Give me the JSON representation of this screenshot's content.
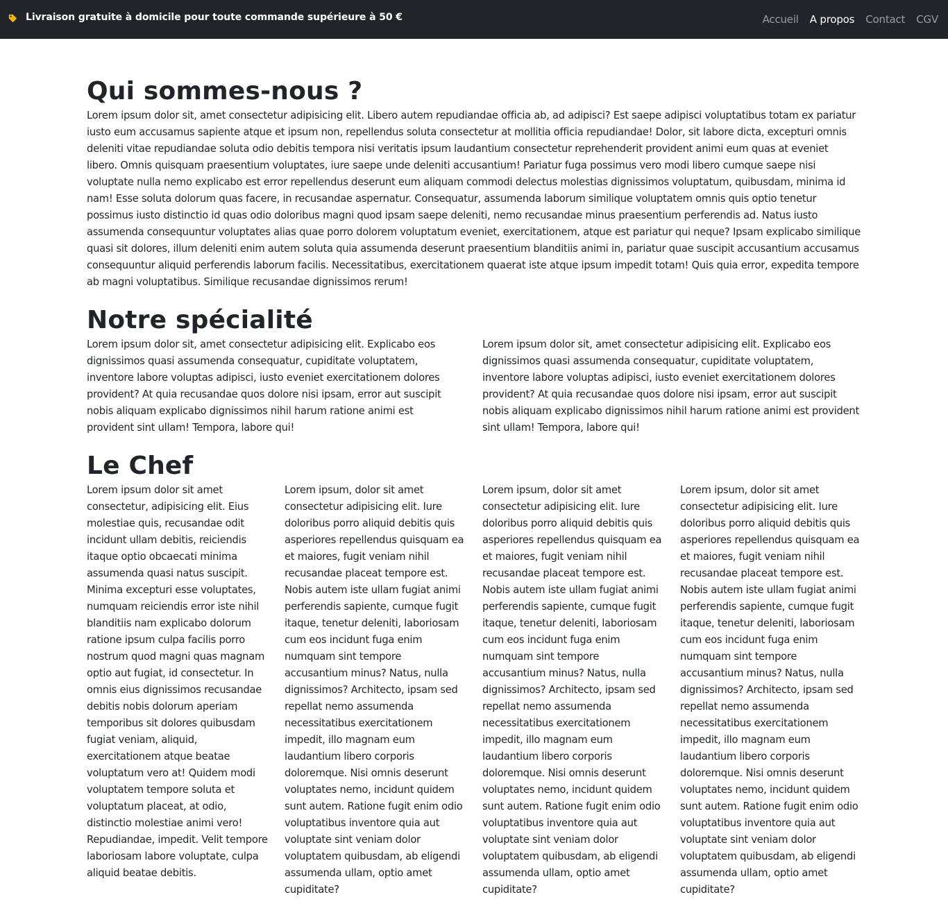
{
  "topbar": {
    "promo_icon": "tag-icon",
    "promo_text": "Livraison gratuite à domicile pour toute commande supérieure à 50 €",
    "nav": [
      {
        "label": "Accueil",
        "active": false
      },
      {
        "label": "A propos",
        "active": true
      },
      {
        "label": "Contact",
        "active": false
      },
      {
        "label": "CGV",
        "active": false
      }
    ]
  },
  "colors": {
    "navbar_bg": "#212529",
    "tag_icon": "#f5b800"
  },
  "sections": {
    "about": {
      "title": "Qui sommes-nous ?",
      "text": "Lorem ipsum dolor sit, amet consectetur adipisicing elit. Libero autem repudiandae officia ab, ad adipisci? Est saepe adipisci voluptatibus totam ex pariatur iusto eum accusamus sapiente atque et ipsum non, repellendus soluta consectetur at mollitia officia repudiandae! Dolor, sit labore dicta, excepturi omnis deleniti vitae repudiandae soluta odio debitis tempora nisi veritatis ipsum laudantium consectetur reprehenderit provident animi eum quas at eveniet libero. Omnis quisquam praesentium voluptates, iure saepe unde deleniti accusantium! Pariatur fuga possimus vero modi libero cumque saepe nisi voluptate nulla nemo explicabo est error repellendus deserunt eum aliquam commodi delectus molestias dignissimos voluptatum, quibusdam, minima id nam! Esse soluta dolorum quas facere, in recusandae aspernatur. Consequatur, assumenda laborum similique voluptatem omnis quis optio tenetur possimus iusto distinctio id quas odio doloribus magni quod ipsam saepe deleniti, nemo recusandae minus praesentium perferendis ad. Natus iusto assumenda consequuntur voluptates alias quae porro dolorem voluptatum eveniet, exercitationem, atque est pariatur qui neque? Ipsam explicabo similique quasi sit dolores, illum deleniti enim autem soluta quia assumenda deserunt praesentium blanditiis animi in, pariatur quae suscipit accusantium accusamus consequuntur aliquid perferendis laborum facilis. Necessitatibus, exercitationem quaerat iste atque ipsum impedit totam! Quis quia error, expedita tempore ab magni voluptatibus. Similique recusandae dignissimos rerum!"
    },
    "specialty": {
      "title": "Notre spécialité",
      "columns": [
        "Lorem ipsum dolor sit, amet consectetur adipisicing elit. Explicabo eos dignissimos quasi assumenda consequatur, cupiditate voluptatem, inventore labore voluptas adipisci, iusto eveniet exercitationem dolores provident? At quia recusandae quos dolore nisi ipsam, error aut suscipit nobis aliquam explicabo dignissimos nihil harum ratione animi est provident sint ullam! Tempora, labore qui!",
        "Lorem ipsum dolor sit, amet consectetur adipisicing elit. Explicabo eos dignissimos quasi assumenda consequatur, cupiditate voluptatem, inventore labore voluptas adipisci, iusto eveniet exercitationem dolores provident? At quia recusandae quos dolore nisi ipsam, error aut suscipit nobis aliquam explicabo dignissimos nihil harum ratione animi est provident sint ullam! Tempora, labore qui!"
      ]
    },
    "chef": {
      "title": "Le Chef",
      "columns": [
        "Lorem ipsum dolor sit amet consectetur, adipisicing elit. Eius molestiae quis, recusandae odit incidunt ullam debitis, reiciendis itaque optio obcaecati minima assumenda quasi natus suscipit. Minima excepturi esse voluptates, numquam reiciendis error iste nihil blanditiis nam explicabo dolorum ratione ipsum culpa facilis porro nostrum quod magni quas magnam optio aut fugiat, id consectetur. In omnis eius dignissimos recusandae debitis nobis dolorum aperiam temporibus sit dolores quibusdam fugiat veniam, aliquid, exercitationem atque beatae voluptatum vero at! Quidem modi voluptatem tempore soluta et voluptatum placeat, at odio, distinctio molestiae animi vero! Repudiandae, impedit. Velit tempore laboriosam labore voluptate, culpa aliquid beatae debitis.",
        "Lorem ipsum, dolor sit amet consectetur adipisicing elit. Iure doloribus porro aliquid debitis quis asperiores repellendus quisquam ea et maiores, fugit veniam nihil recusandae placeat tempore est. Nobis autem iste ullam fugiat animi perferendis sapiente, cumque fugit itaque, tenetur deleniti, laboriosam cum eos incidunt fuga enim numquam sint tempore accusantium minus? Natus, nulla dignissimos? Architecto, ipsam sed repellat nemo assumenda necessitatibus exercitationem impedit, illo magnam eum laudantium libero corporis doloremque. Nisi omnis deserunt voluptates nemo, incidunt quidem sunt autem. Ratione fugit enim odio voluptatibus inventore quia aut voluptate sint veniam dolor voluptatem quibusdam, ab eligendi assumenda ullam, optio amet cupiditate?",
        "Lorem ipsum, dolor sit amet consectetur adipisicing elit. Iure doloribus porro aliquid debitis quis asperiores repellendus quisquam ea et maiores, fugit veniam nihil recusandae placeat tempore est. Nobis autem iste ullam fugiat animi perferendis sapiente, cumque fugit itaque, tenetur deleniti, laboriosam cum eos incidunt fuga enim numquam sint tempore accusantium minus? Natus, nulla dignissimos? Architecto, ipsam sed repellat nemo assumenda necessitatibus exercitationem impedit, illo magnam eum laudantium libero corporis doloremque. Nisi omnis deserunt voluptates nemo, incidunt quidem sunt autem. Ratione fugit enim odio voluptatibus inventore quia aut voluptate sint veniam dolor voluptatem quibusdam, ab eligendi assumenda ullam, optio amet cupiditate?",
        "Lorem ipsum, dolor sit amet consectetur adipisicing elit. Iure doloribus porro aliquid debitis quis asperiores repellendus quisquam ea et maiores, fugit veniam nihil recusandae placeat tempore est. Nobis autem iste ullam fugiat animi perferendis sapiente, cumque fugit itaque, tenetur deleniti, laboriosam cum eos incidunt fuga enim numquam sint tempore accusantium minus? Natus, nulla dignissimos? Architecto, ipsam sed repellat nemo assumenda necessitatibus exercitationem impedit, illo magnam eum laudantium libero corporis doloremque. Nisi omnis deserunt voluptates nemo, incidunt quidem sunt autem. Ratione fugit enim odio voluptatibus inventore quia aut voluptate sint veniam dolor voluptatem quibusdam, ab eligendi assumenda ullam, optio amet cupiditate?"
      ]
    }
  }
}
